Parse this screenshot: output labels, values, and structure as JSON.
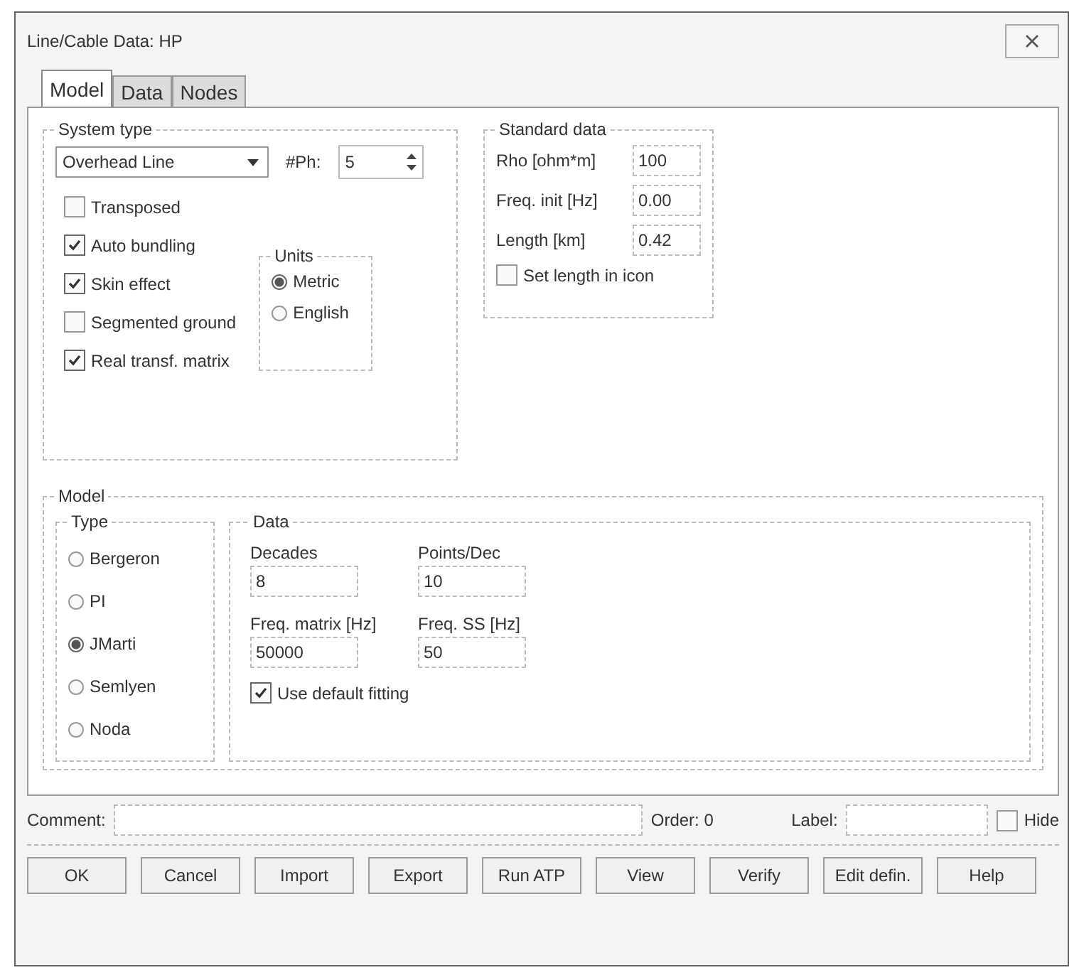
{
  "window": {
    "title": "Line/Cable Data: HP"
  },
  "tabs": [
    {
      "label": "Model",
      "selected": true
    },
    {
      "label": "Data",
      "selected": false
    },
    {
      "label": "Nodes",
      "selected": false
    }
  ],
  "system_type": {
    "title": "System type",
    "dropdown": "Overhead Line",
    "phases_label": "#Ph:",
    "phases": "5",
    "options": [
      {
        "label": "Transposed",
        "checked": false
      },
      {
        "label": "Auto bundling",
        "checked": true
      },
      {
        "label": "Skin effect",
        "checked": true
      },
      {
        "label": "Segmented ground",
        "checked": false
      },
      {
        "label": "Real transf. matrix",
        "checked": true
      }
    ],
    "units": {
      "title": "Units",
      "options": [
        {
          "label": "Metric",
          "selected": true
        },
        {
          "label": "English",
          "selected": false
        }
      ]
    }
  },
  "standard_data": {
    "title": "Standard data",
    "fields": [
      {
        "label": "Rho [ohm*m]",
        "value": "100"
      },
      {
        "label": "Freq. init [Hz]",
        "value": "0.00"
      },
      {
        "label": "Length [km]",
        "value": "0.42"
      }
    ],
    "set_length": {
      "label": "Set length in icon",
      "checked": false
    }
  },
  "model": {
    "title": "Model",
    "type": {
      "title": "Type",
      "options": [
        {
          "label": "Bergeron",
          "selected": false
        },
        {
          "label": "PI",
          "selected": false
        },
        {
          "label": "JMarti",
          "selected": true
        },
        {
          "label": "Semlyen",
          "selected": false
        },
        {
          "label": "Noda",
          "selected": false
        }
      ]
    },
    "data": {
      "title": "Data",
      "fields": [
        {
          "label": "Decades",
          "value": "8"
        },
        {
          "label": "Points/Dec",
          "value": "10"
        },
        {
          "label": "Freq. matrix [Hz]",
          "value": "50000"
        },
        {
          "label": "Freq. SS [Hz]",
          "value": "50"
        }
      ],
      "default_fitting": {
        "label": "Use default fitting",
        "checked": true
      }
    }
  },
  "footer": {
    "comment_label": "Comment:",
    "order_label": "Order: 0",
    "label_label": "Label:",
    "hide": {
      "label": "Hide",
      "checked": false
    }
  },
  "buttons": [
    "OK",
    "Cancel",
    "Import",
    "Export",
    "Run ATP",
    "View",
    "Verify",
    "Edit defin.",
    "Help"
  ]
}
